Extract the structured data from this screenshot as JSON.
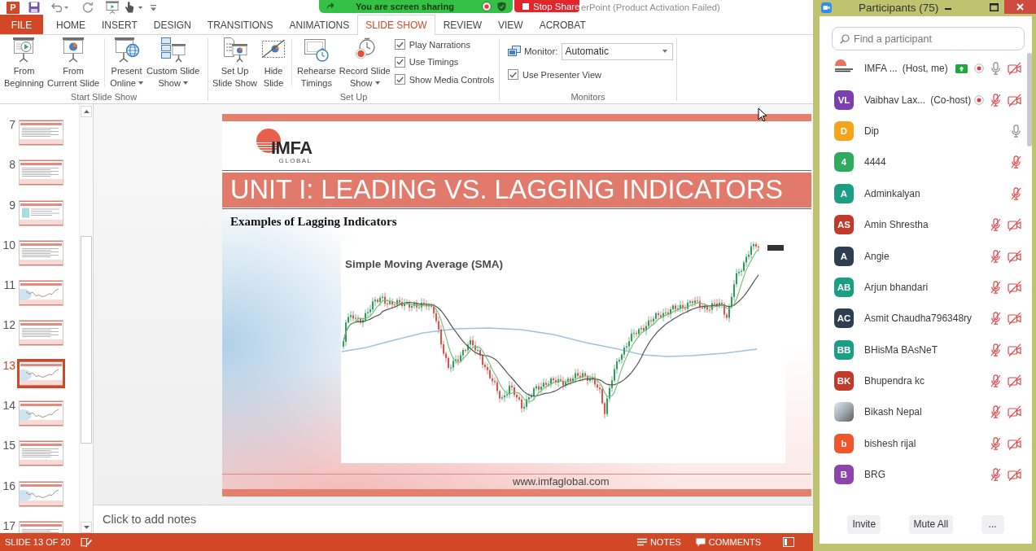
{
  "title_bar": {
    "app_logo": "P",
    "title": "erPoint (Product Activation Failed)"
  },
  "share_bar": {
    "status": "You are screen sharing",
    "stop_button": "Stop Share"
  },
  "tabs": [
    {
      "label": "FILE",
      "kind": "file",
      "selected": false
    },
    {
      "label": "HOME",
      "kind": "tab",
      "selected": false
    },
    {
      "label": "INSERT",
      "kind": "tab",
      "selected": false
    },
    {
      "label": "DESIGN",
      "kind": "tab",
      "selected": false
    },
    {
      "label": "TRANSITIONS",
      "kind": "tab",
      "selected": false
    },
    {
      "label": "ANIMATIONS",
      "kind": "tab",
      "selected": false
    },
    {
      "label": "SLIDE SHOW",
      "kind": "tab",
      "selected": true
    },
    {
      "label": "REVIEW",
      "kind": "tab",
      "selected": false
    },
    {
      "label": "VIEW",
      "kind": "tab",
      "selected": false
    },
    {
      "label": "ACROBAT",
      "kind": "tab",
      "selected": false
    }
  ],
  "ribbon": {
    "groups": [
      {
        "label": "Start Slide Show",
        "sections": [
          [
            {
              "kind": "large_button",
              "lines": [
                "From",
                "Beginning"
              ],
              "dropdown": false
            },
            {
              "kind": "large_button",
              "lines": [
                "From",
                "Current Slide"
              ],
              "dropdown": false
            }
          ],
          [
            {
              "kind": "large_button",
              "lines": [
                "Present",
                "Online"
              ],
              "dropdown": true
            },
            {
              "kind": "large_button",
              "lines": [
                "Custom Slide",
                "Show"
              ],
              "dropdown": true
            }
          ]
        ]
      },
      {
        "label": "Set Up",
        "sections": [
          [
            {
              "kind": "large_button",
              "lines": [
                "Set Up",
                "Slide Show"
              ],
              "dropdown": false
            },
            {
              "kind": "large_button",
              "lines": [
                "Hide",
                "Slide"
              ],
              "dropdown": false
            }
          ],
          [
            {
              "kind": "large_button",
              "lines": [
                "Rehearse",
                "Timings"
              ],
              "dropdown": false
            },
            {
              "kind": "large_button",
              "lines": [
                "Record Slide",
                "Show"
              ],
              "dropdown": true
            }
          ],
          [
            {
              "kind": "checkbox",
              "label": "Play Narrations",
              "checked": true
            },
            {
              "kind": "checkbox",
              "label": "Use Timings",
              "checked": true
            },
            {
              "kind": "checkbox",
              "label": "Show Media Controls",
              "checked": true
            }
          ]
        ]
      },
      {
        "label": "Monitors",
        "sections": [
          [
            {
              "kind": "select",
              "label": "Monitor:",
              "value": "Automatic"
            },
            {
              "kind": "checkbox",
              "label": "Use Presenter View",
              "checked": true
            }
          ]
        ]
      }
    ]
  },
  "slides": [
    {
      "number": "7",
      "kind": "text",
      "selected": false
    },
    {
      "number": "8",
      "kind": "text",
      "selected": false
    },
    {
      "number": "9",
      "kind": "panel",
      "selected": false
    },
    {
      "number": "10",
      "kind": "text",
      "selected": false
    },
    {
      "number": "11",
      "kind": "chart",
      "selected": false
    },
    {
      "number": "12",
      "kind": "text",
      "selected": false
    },
    {
      "number": "13",
      "kind": "chart",
      "selected": true
    },
    {
      "number": "14",
      "kind": "chart",
      "selected": false
    },
    {
      "number": "15",
      "kind": "text",
      "selected": false
    },
    {
      "number": "16",
      "kind": "chart",
      "selected": false
    },
    {
      "number": "17",
      "kind": "text",
      "selected": false
    }
  ],
  "slide": {
    "logo": {
      "name": "IMFA",
      "tagline": "GLOBAL"
    },
    "heading": "UNIT I: LEADING VS. LAGGING INDICATORS",
    "subheading": "Examples of Lagging Indicators",
    "figure": {
      "title": "Simple Moving Average (SMA)"
    },
    "footer": "www.imfaglobal.com"
  },
  "notes": {
    "placeholder": "Click to add notes"
  },
  "status_bar": {
    "position": "SLIDE 13 OF 20",
    "buttons": [
      "NOTES",
      "COMMENTS"
    ]
  },
  "participants_panel": {
    "title": "Participants (75)",
    "search": {
      "placeholder": "Find a participant"
    },
    "participants": [
      {
        "avatar": {
          "kind": "logo"
        },
        "name": "IMFA ...",
        "role": "(Host, me)",
        "sharing": true,
        "recording": true,
        "muted": false,
        "camera_off": true
      },
      {
        "avatar": {
          "kind": "initials",
          "initials": "VL",
          "color": "#7b3fb2"
        },
        "name": "Vaibhav Lax...",
        "role": "(Co-host)",
        "sharing": false,
        "recording": true,
        "muted": true,
        "camera_off": true
      },
      {
        "avatar": {
          "kind": "initials",
          "initials": "D",
          "color": "#f5a31a"
        },
        "name": "Dip",
        "sharing": false,
        "recording": false,
        "muted": false
      },
      {
        "avatar": {
          "kind": "initials",
          "initials": "4",
          "color": "#2eab5f"
        },
        "name": "4444",
        "sharing": false,
        "recording": false,
        "muted": true
      },
      {
        "avatar": {
          "kind": "initials",
          "initials": "A",
          "color": "#1b9e84"
        },
        "name": "Adminkalyan",
        "sharing": false,
        "recording": false,
        "muted": true
      },
      {
        "avatar": {
          "kind": "initials",
          "initials": "AS",
          "color": "#c0392b"
        },
        "name": "Amin Shrestha",
        "sharing": false,
        "recording": false,
        "muted": true,
        "camera_off": true
      },
      {
        "avatar": {
          "kind": "initials",
          "initials": "A",
          "color": "#2c3e50"
        },
        "name": "Angie",
        "sharing": false,
        "recording": false,
        "muted": true,
        "camera_off": true
      },
      {
        "avatar": {
          "kind": "initials",
          "initials": "AB",
          "color": "#1b9e84"
        },
        "name": "Arjun bhandari",
        "sharing": false,
        "recording": false,
        "muted": true,
        "camera_off": true
      },
      {
        "avatar": {
          "kind": "initials",
          "initials": "AC",
          "color": "#2c3e50"
        },
        "name": "Asmit Chaudha796348ry",
        "sharing": false,
        "recording": false,
        "muted": true,
        "camera_off": true
      },
      {
        "avatar": {
          "kind": "initials",
          "initials": "BB",
          "color": "#1b9e84"
        },
        "name": "BHisMa BAsNeT",
        "sharing": false,
        "recording": false,
        "muted": true,
        "camera_off": true
      },
      {
        "avatar": {
          "kind": "initials",
          "initials": "BK",
          "color": "#c0392b"
        },
        "name": "Bhupendra kc",
        "sharing": false,
        "recording": false,
        "muted": true,
        "camera_off": true
      },
      {
        "avatar": {
          "kind": "photo"
        },
        "name": "Bikash Nepal",
        "sharing": false,
        "recording": false,
        "muted": true,
        "camera_off": true
      },
      {
        "avatar": {
          "kind": "initials",
          "initials": "b",
          "color": "#f2552c"
        },
        "name": "bishesh rijal",
        "sharing": false,
        "recording": false,
        "muted": true,
        "camera_off": true
      },
      {
        "avatar": {
          "kind": "initials",
          "initials": "B",
          "color": "#8e44ad"
        },
        "name": "BRG",
        "sharing": false,
        "recording": false,
        "muted": true,
        "camera_off": true
      }
    ],
    "buttons": [
      "Invite",
      "Mute All",
      "..."
    ]
  }
}
